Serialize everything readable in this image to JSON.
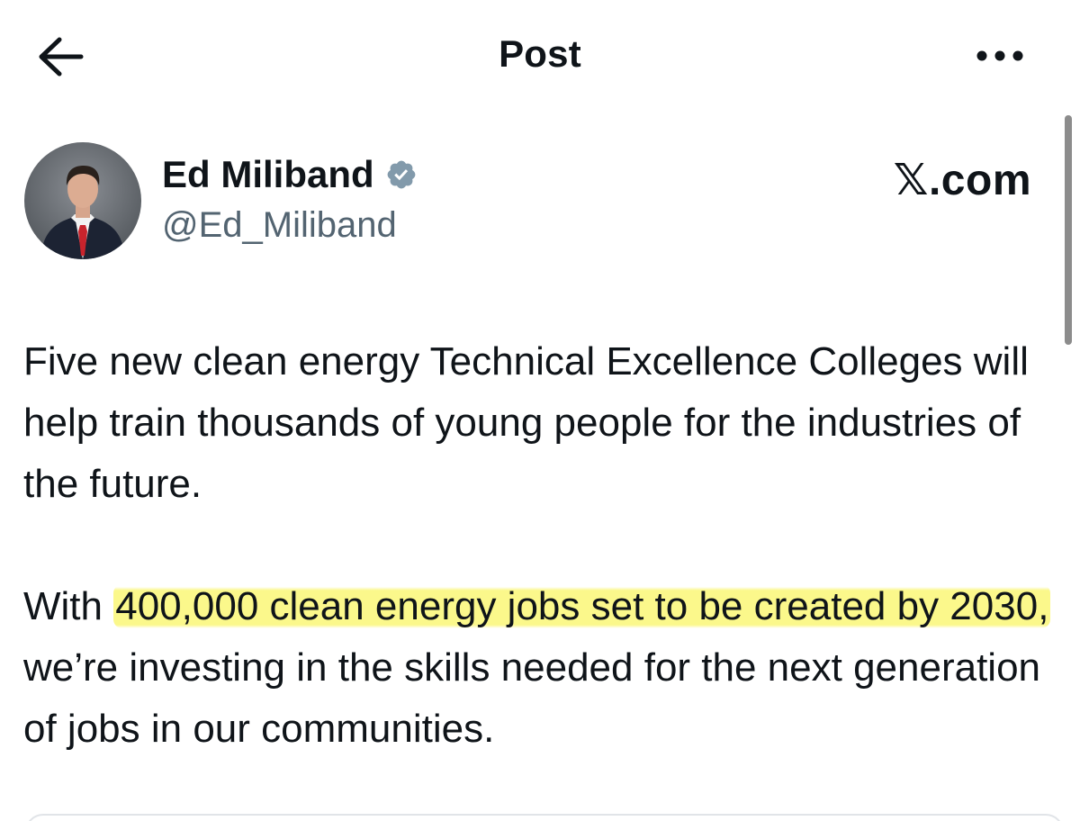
{
  "header": {
    "title": "Post",
    "back_icon": "arrow-left-icon",
    "more_icon": "more-horizontal-icon"
  },
  "author": {
    "name": "Ed Miliband",
    "handle": "@Ed_Miliband",
    "verified_icon": "verified-badge-icon",
    "verified_color": "#829aab"
  },
  "source": "𝕏.com",
  "post": {
    "paragraph1": "Five new clean energy Technical Excellence Colleges will help train thousands of young people for the industries of the future.",
    "paragraph2_prefix": "With ",
    "paragraph2_highlight": "400,000 clean energy jobs set to be created by 2030,",
    "paragraph2_suffix": " we’re investing in the skills needed for the next generation of jobs in our communities."
  },
  "colors": {
    "text": "#0f1419",
    "secondary_text": "#536471",
    "highlight": "#fbf88b"
  }
}
